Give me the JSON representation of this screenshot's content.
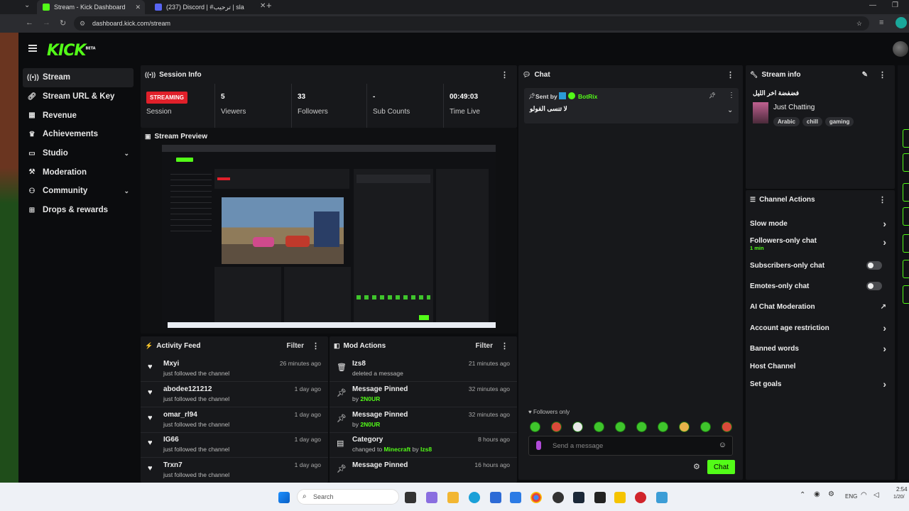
{
  "browser": {
    "tabs": [
      {
        "label": "Stream - Kick Dashboard",
        "favicon_color": "#53fc18"
      },
      {
        "label": "(237) Discord | #ترحيب | sla",
        "favicon_color": "#5865f2"
      }
    ],
    "url": "dashboard.kick.com/stream",
    "new_tab": "+"
  },
  "header": {
    "logo": "KICK",
    "logo_badge": "BETA"
  },
  "sidebar": {
    "items": [
      {
        "label": "Stream",
        "icon": "broadcast-icon"
      },
      {
        "label": "Stream URL & Key",
        "icon": "link-icon"
      },
      {
        "label": "Revenue",
        "icon": "chart-icon"
      },
      {
        "label": "Achievements",
        "icon": "trophy-icon"
      },
      {
        "label": "Studio",
        "icon": "monitor-icon"
      },
      {
        "label": "Moderation",
        "icon": "hammer-icon"
      },
      {
        "label": "Community",
        "icon": "people-icon"
      },
      {
        "label": "Drops & rewards",
        "icon": "gift-icon"
      }
    ]
  },
  "session": {
    "title": "Session Info",
    "status_badge": "STREAMING",
    "session_label": "Session",
    "viewers_value": "5",
    "viewers_label": "Viewers",
    "followers_value": "33",
    "followers_label": "Followers",
    "subs_value": "-",
    "subs_label": "Sub Counts",
    "time_value": "00:49:03",
    "time_label": "Time Live"
  },
  "preview": {
    "title": "Stream Preview"
  },
  "activity": {
    "title": "Activity Feed",
    "filter": "Filter",
    "items": [
      {
        "name": "Mxyi",
        "text": "just followed the channel",
        "time": "26 minutes ago"
      },
      {
        "name": "abodee121212",
        "text": "just followed the channel",
        "time": "1 day ago"
      },
      {
        "name": "omar_rl94",
        "text": "just followed the channel",
        "time": "1 day ago"
      },
      {
        "name": "IG66",
        "text": "just followed the channel",
        "time": "1 day ago"
      },
      {
        "name": "Trxn7",
        "text": "just followed the channel",
        "time": "1 day ago"
      }
    ]
  },
  "mod": {
    "title": "Mod Actions",
    "filter": "Filter",
    "items": [
      {
        "name": "Izs8",
        "text": "deleted a message",
        "time": "21 minutes ago"
      },
      {
        "name": "Message Pinned",
        "by": "by",
        "user": "2N0UR",
        "time": "32 minutes ago"
      },
      {
        "name": "Message Pinned",
        "by": "by",
        "user": "2N0UR",
        "time": "32 minutes ago"
      },
      {
        "name": "Category",
        "text": "changed to",
        "target": "Minecraft",
        "by": "by",
        "user": "Izs8",
        "time": "8 hours ago"
      },
      {
        "name": "Message Pinned",
        "time": "16 hours ago"
      }
    ]
  },
  "chat": {
    "title": "Chat",
    "pinned_sent_by": "Sent by",
    "pinned_user": "BotRix",
    "pinned_message": "لا تنسى الفولو",
    "followers_only": "Followers only",
    "input_placeholder": "Send a message",
    "send_button": "Chat"
  },
  "stream_info": {
    "title": "Stream info",
    "stream_title": "فضفضة اخر الليل",
    "category": "Just Chatting",
    "tags": [
      "Arabic",
      "chill",
      "gaming"
    ]
  },
  "channel_actions": {
    "title": "Channel Actions",
    "slow_mode": "Slow mode",
    "followers_only_chat": "Followers-only chat",
    "followers_only_sub": "1 min",
    "subscribers_only_chat": "Subscribers-only chat",
    "emotes_only_chat": "Emotes-only chat",
    "ai_moderation": "AI Chat Moderation",
    "account_age": "Account age restriction",
    "banned_words": "Banned words",
    "host_channel": "Host Channel",
    "set_goals": "Set goals"
  },
  "taskbar": {
    "search": "Search",
    "lang": "ENG",
    "time": "2:54",
    "date": "1/20/"
  },
  "colors": {
    "accent": "#53fc18",
    "live": "#e0202a",
    "panel": "#17181b"
  }
}
